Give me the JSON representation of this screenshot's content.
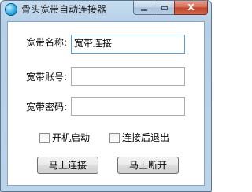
{
  "window": {
    "title": "骨头宽带自动连接器",
    "icon": "app-globe-icon",
    "caption_buttons": {
      "minimize_icon": "minimize-icon",
      "maximize_icon": "maximize-icon",
      "close_label": "X"
    }
  },
  "form": {
    "name_label": "宽带名称:",
    "name_value": "宽带连接",
    "account_label": "宽带账号:",
    "account_value": "",
    "password_label": "宽带密码:",
    "password_value": ""
  },
  "options": {
    "autostart_label": "开机启动",
    "autostart_checked": false,
    "exit_after_connect_label": "连接后退出",
    "exit_after_connect_checked": false
  },
  "actions": {
    "connect_label": "马上连接",
    "disconnect_label": "马上断开"
  }
}
